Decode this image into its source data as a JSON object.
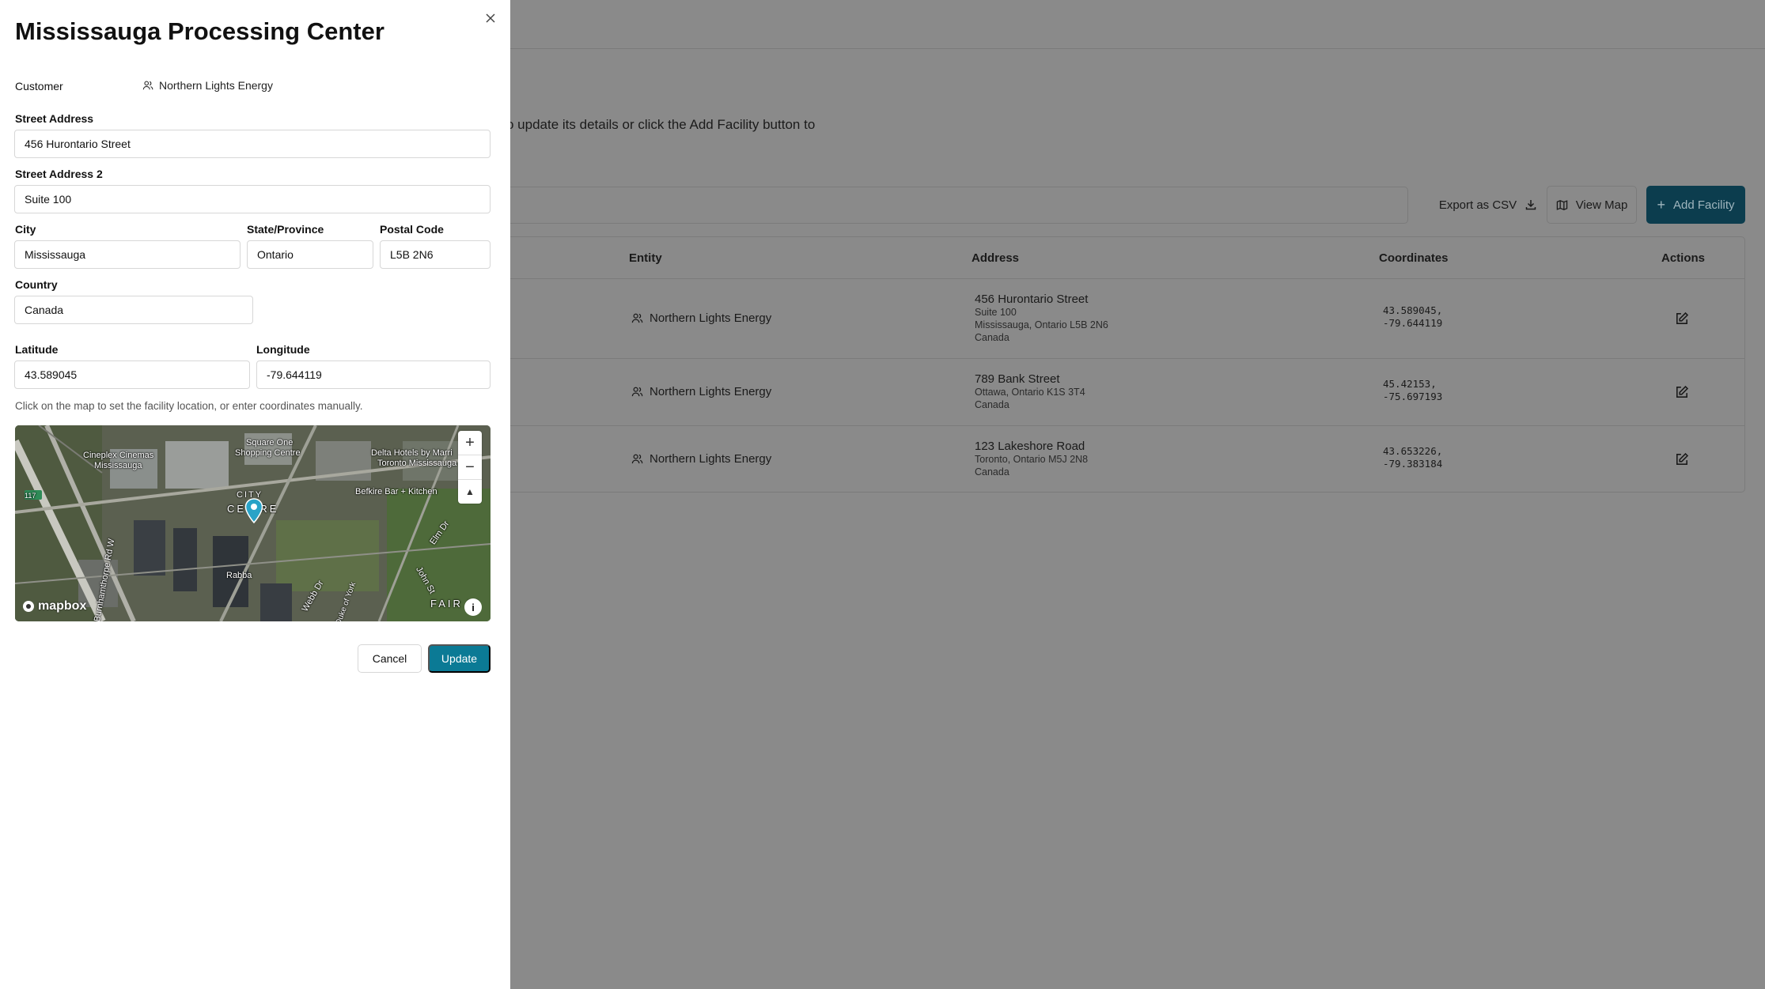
{
  "background": {
    "description_fragment": "o update its details or click the Add Facility button to",
    "toolbar": {
      "export_label": "Export as CSV",
      "view_map_label": "View Map",
      "add_label": "Add Facility"
    },
    "table": {
      "columns": [
        "Entity",
        "Address",
        "Coordinates",
        "Actions"
      ],
      "rows": [
        {
          "entity": "Northern Lights Energy",
          "address_line1": "456 Hurontario Street",
          "address_line2": "Suite 100",
          "address_line3": "Mississauga, Ontario L5B 2N6",
          "address_line4": "Canada",
          "coord_lat": "43.589045,",
          "coord_lng": "-79.644119"
        },
        {
          "entity": "Northern Lights Energy",
          "address_line1": "789 Bank Street",
          "address_line2": "Ottawa, Ontario K1S 3T4",
          "address_line3": "Canada",
          "coord_lat": "45.42153,",
          "coord_lng": "-75.697193"
        },
        {
          "entity": "Northern Lights Energy",
          "address_line1": "123 Lakeshore Road",
          "address_line2": "Toronto, Ontario M5J 2N8",
          "address_line3": "Canada",
          "coord_lat": "43.653226,",
          "coord_lng": "-79.383184"
        }
      ]
    }
  },
  "drawer": {
    "title": "Mississauga Processing Center",
    "customer_label": "Customer",
    "customer_value": "Northern Lights Energy",
    "street_label": "Street Address",
    "street_value": "456 Hurontario Street",
    "street2_label": "Street Address 2",
    "street2_value": "Suite 100",
    "city_label": "City",
    "city_value": "Mississauga",
    "state_label": "State/Province",
    "state_value": "Ontario",
    "postal_label": "Postal Code",
    "postal_value": "L5B 2N6",
    "country_label": "Country",
    "country_value": "Canada",
    "lat_label": "Latitude",
    "lat_value": "43.589045",
    "lng_label": "Longitude",
    "lng_value": "-79.644119",
    "hint": "Click on the map to set the facility location, or enter coordinates manually.",
    "map": {
      "labels": {
        "cineplex": "Cineplex Cinemas",
        "cineplex2": "Mississauga",
        "square_one": "Square One",
        "square_one2": "Shopping Centre",
        "delta": "Delta Hotels by Marri",
        "delta2": "Toronto Mississauga",
        "befkire": "Befkire Bar + Kitchen",
        "city": "CITY",
        "centre": "CE  TRE",
        "rabba": "Rabba",
        "fairview": "FAIR   W",
        "road_117": "117",
        "webb": "Webb Dr",
        "duke": "Duke of York",
        "elm": "Elm Dr",
        "john": "John St",
        "bur": "Burnhamthorpe Rd W"
      },
      "logo": "mapbox",
      "zoom_in": "+",
      "zoom_out": "−",
      "compass": "▲"
    },
    "cancel_label": "Cancel",
    "update_label": "Update",
    "accent_color": "#0b7a95"
  }
}
